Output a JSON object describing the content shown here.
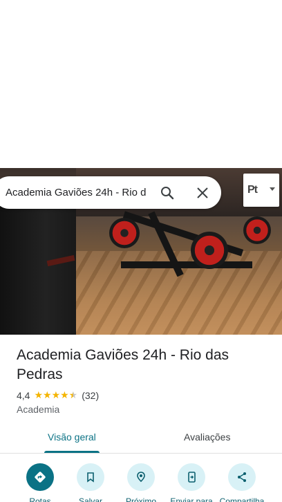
{
  "search": {
    "query": "Academia Gaviões 24h - Rio d"
  },
  "language_button": {
    "code": "Pt"
  },
  "place": {
    "name": "Academia Gaviões 24h - Rio das Pedras",
    "rating": "4,4",
    "review_count": "(32)",
    "stars": 4.4,
    "category": "Academia"
  },
  "tabs": [
    {
      "label": "Visão geral",
      "selected": true
    },
    {
      "label": "Avaliações",
      "selected": false
    }
  ],
  "actions": [
    {
      "label": "Rotas",
      "icon": "directions-icon"
    },
    {
      "label": "Salvar",
      "icon": "bookmark-icon"
    },
    {
      "label": "Próximo",
      "icon": "nearby-icon"
    },
    {
      "label": "Enviar para",
      "icon": "send-to-phone-icon"
    },
    {
      "label": "Compartilha",
      "icon": "share-icon"
    }
  ],
  "colors": {
    "accent": "#0b7285",
    "action_bg": "#d8f1f6",
    "star": "#f4b400"
  }
}
